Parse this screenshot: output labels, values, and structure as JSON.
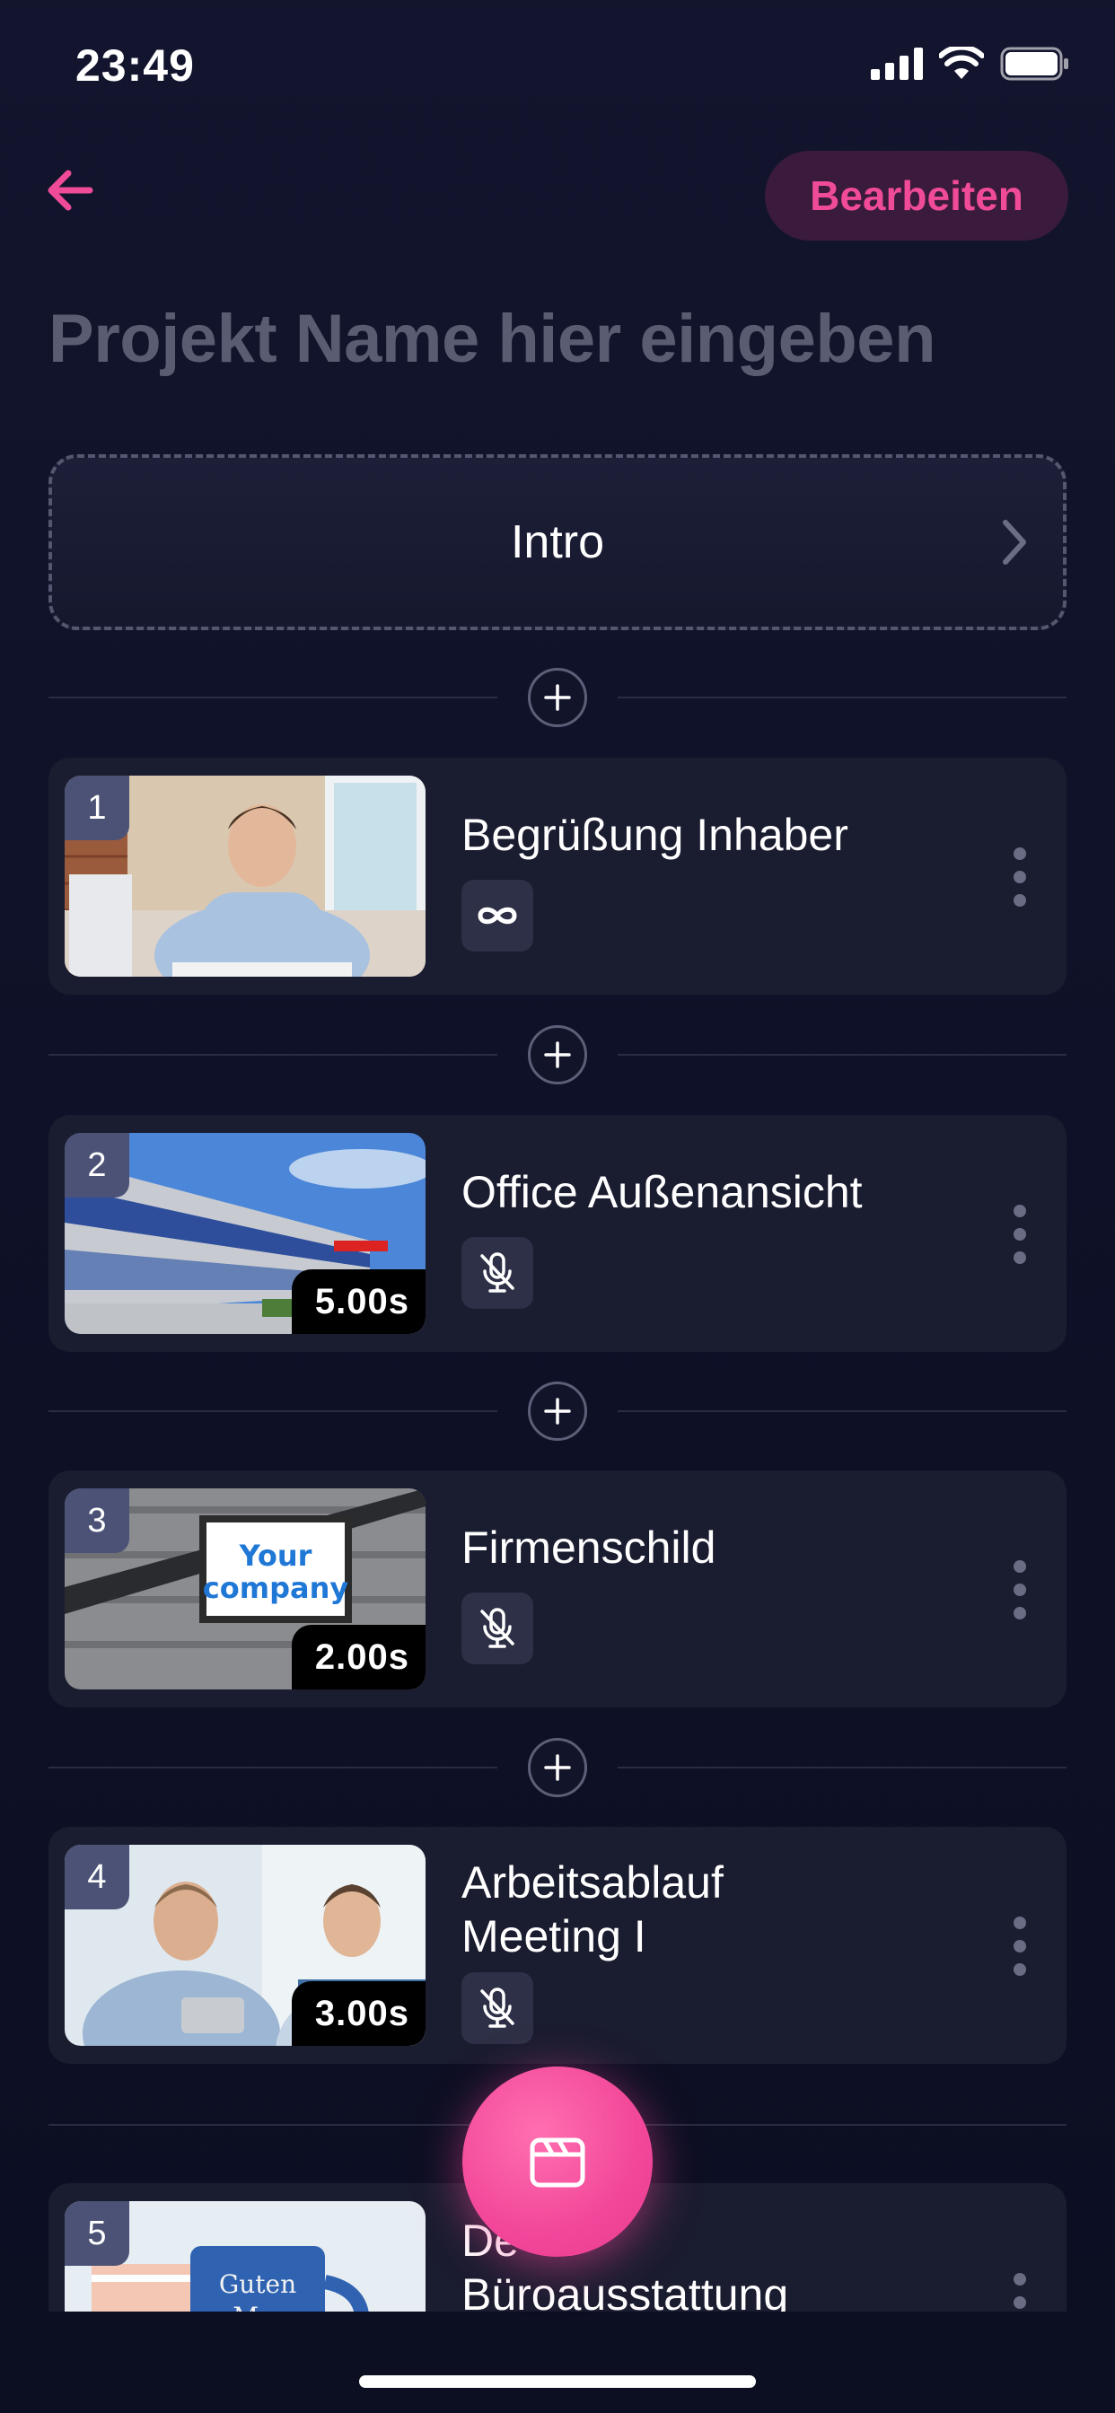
{
  "status_bar": {
    "time": "23:49"
  },
  "header": {
    "edit_label": "Bearbeiten",
    "project_name_placeholder": "Projekt Name hier eingeben"
  },
  "intro": {
    "label": "Intro"
  },
  "clips": [
    {
      "index": "1",
      "title": "Begrüßung Inhaber",
      "title_line2": "",
      "duration": "",
      "chip_icon": "infinity-icon"
    },
    {
      "index": "2",
      "title": "Office Außenansicht",
      "title_line2": "",
      "duration": "5.00s",
      "chip_icon": "mic-off-icon"
    },
    {
      "index": "3",
      "title": "Firmenschild",
      "title_line2": "",
      "duration": "2.00s",
      "chip_icon": "mic-off-icon",
      "sign_text_1": "Your",
      "sign_text_2": "company"
    },
    {
      "index": "4",
      "title": "Arbeitsablauf",
      "title_line2": "Meeting I",
      "duration": "3.00s",
      "chip_icon": "mic-off-icon"
    },
    {
      "index": "5",
      "title": "De",
      "title_line2": "Büroausstattung",
      "duration": "",
      "chip_icon": "",
      "mug_text_1": "Guten",
      "mug_text_2": "M..."
    }
  ],
  "colors": {
    "accent": "#f04b98",
    "background": "#0f1128",
    "card": "#1a1c30"
  }
}
